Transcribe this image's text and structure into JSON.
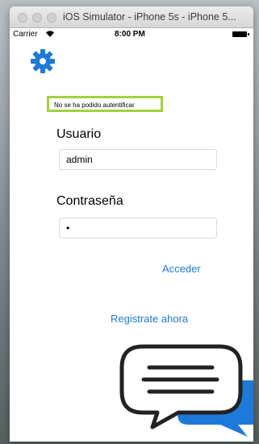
{
  "window": {
    "title": "iOS Simulator - iPhone 5s - iPhone 5..."
  },
  "status_bar": {
    "carrier": "Carrier",
    "wifi_icon": "wifi-icon",
    "time": "8:00 PM",
    "battery_icon": "battery-icon"
  },
  "settings": {
    "icon": "gear-icon",
    "color": "#1d7ad9"
  },
  "login": {
    "error_message": "No se ha podido autentificar",
    "error_border_color": "#a4d13a",
    "username_label": "Usuario",
    "username_value": "admin",
    "password_label": "Contraseña",
    "password_value": "•",
    "submit_label": "Acceder",
    "register_label": "Registrate ahora",
    "link_color": "#1d7ad9"
  },
  "illustration": {
    "icon": "chat-bubbles-icon"
  }
}
